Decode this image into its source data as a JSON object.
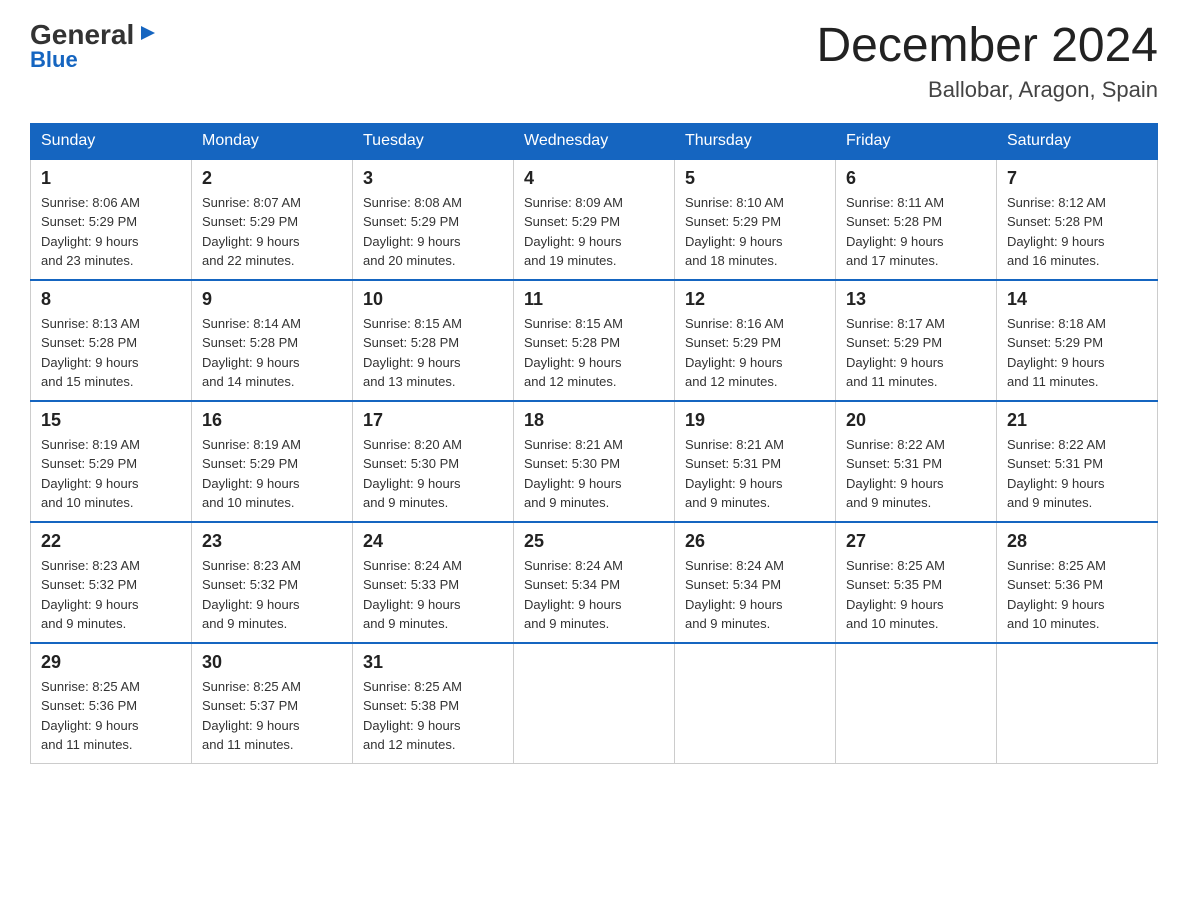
{
  "logo": {
    "general_text": "General",
    "blue_text": "Blue"
  },
  "title": "December 2024",
  "location": "Ballobar, Aragon, Spain",
  "days_of_week": [
    "Sunday",
    "Monday",
    "Tuesday",
    "Wednesday",
    "Thursday",
    "Friday",
    "Saturday"
  ],
  "weeks": [
    [
      {
        "day": "1",
        "sunrise": "8:06 AM",
        "sunset": "5:29 PM",
        "daylight": "9 hours and 23 minutes."
      },
      {
        "day": "2",
        "sunrise": "8:07 AM",
        "sunset": "5:29 PM",
        "daylight": "9 hours and 22 minutes."
      },
      {
        "day": "3",
        "sunrise": "8:08 AM",
        "sunset": "5:29 PM",
        "daylight": "9 hours and 20 minutes."
      },
      {
        "day": "4",
        "sunrise": "8:09 AM",
        "sunset": "5:29 PM",
        "daylight": "9 hours and 19 minutes."
      },
      {
        "day": "5",
        "sunrise": "8:10 AM",
        "sunset": "5:29 PM",
        "daylight": "9 hours and 18 minutes."
      },
      {
        "day": "6",
        "sunrise": "8:11 AM",
        "sunset": "5:28 PM",
        "daylight": "9 hours and 17 minutes."
      },
      {
        "day": "7",
        "sunrise": "8:12 AM",
        "sunset": "5:28 PM",
        "daylight": "9 hours and 16 minutes."
      }
    ],
    [
      {
        "day": "8",
        "sunrise": "8:13 AM",
        "sunset": "5:28 PM",
        "daylight": "9 hours and 15 minutes."
      },
      {
        "day": "9",
        "sunrise": "8:14 AM",
        "sunset": "5:28 PM",
        "daylight": "9 hours and 14 minutes."
      },
      {
        "day": "10",
        "sunrise": "8:15 AM",
        "sunset": "5:28 PM",
        "daylight": "9 hours and 13 minutes."
      },
      {
        "day": "11",
        "sunrise": "8:15 AM",
        "sunset": "5:28 PM",
        "daylight": "9 hours and 12 minutes."
      },
      {
        "day": "12",
        "sunrise": "8:16 AM",
        "sunset": "5:29 PM",
        "daylight": "9 hours and 12 minutes."
      },
      {
        "day": "13",
        "sunrise": "8:17 AM",
        "sunset": "5:29 PM",
        "daylight": "9 hours and 11 minutes."
      },
      {
        "day": "14",
        "sunrise": "8:18 AM",
        "sunset": "5:29 PM",
        "daylight": "9 hours and 11 minutes."
      }
    ],
    [
      {
        "day": "15",
        "sunrise": "8:19 AM",
        "sunset": "5:29 PM",
        "daylight": "9 hours and 10 minutes."
      },
      {
        "day": "16",
        "sunrise": "8:19 AM",
        "sunset": "5:29 PM",
        "daylight": "9 hours and 10 minutes."
      },
      {
        "day": "17",
        "sunrise": "8:20 AM",
        "sunset": "5:30 PM",
        "daylight": "9 hours and 9 minutes."
      },
      {
        "day": "18",
        "sunrise": "8:21 AM",
        "sunset": "5:30 PM",
        "daylight": "9 hours and 9 minutes."
      },
      {
        "day": "19",
        "sunrise": "8:21 AM",
        "sunset": "5:31 PM",
        "daylight": "9 hours and 9 minutes."
      },
      {
        "day": "20",
        "sunrise": "8:22 AM",
        "sunset": "5:31 PM",
        "daylight": "9 hours and 9 minutes."
      },
      {
        "day": "21",
        "sunrise": "8:22 AM",
        "sunset": "5:31 PM",
        "daylight": "9 hours and 9 minutes."
      }
    ],
    [
      {
        "day": "22",
        "sunrise": "8:23 AM",
        "sunset": "5:32 PM",
        "daylight": "9 hours and 9 minutes."
      },
      {
        "day": "23",
        "sunrise": "8:23 AM",
        "sunset": "5:32 PM",
        "daylight": "9 hours and 9 minutes."
      },
      {
        "day": "24",
        "sunrise": "8:24 AM",
        "sunset": "5:33 PM",
        "daylight": "9 hours and 9 minutes."
      },
      {
        "day": "25",
        "sunrise": "8:24 AM",
        "sunset": "5:34 PM",
        "daylight": "9 hours and 9 minutes."
      },
      {
        "day": "26",
        "sunrise": "8:24 AM",
        "sunset": "5:34 PM",
        "daylight": "9 hours and 9 minutes."
      },
      {
        "day": "27",
        "sunrise": "8:25 AM",
        "sunset": "5:35 PM",
        "daylight": "9 hours and 10 minutes."
      },
      {
        "day": "28",
        "sunrise": "8:25 AM",
        "sunset": "5:36 PM",
        "daylight": "9 hours and 10 minutes."
      }
    ],
    [
      {
        "day": "29",
        "sunrise": "8:25 AM",
        "sunset": "5:36 PM",
        "daylight": "9 hours and 11 minutes."
      },
      {
        "day": "30",
        "sunrise": "8:25 AM",
        "sunset": "5:37 PM",
        "daylight": "9 hours and 11 minutes."
      },
      {
        "day": "31",
        "sunrise": "8:25 AM",
        "sunset": "5:38 PM",
        "daylight": "9 hours and 12 minutes."
      },
      null,
      null,
      null,
      null
    ]
  ],
  "labels": {
    "sunrise": "Sunrise:",
    "sunset": "Sunset:",
    "daylight": "Daylight:"
  }
}
